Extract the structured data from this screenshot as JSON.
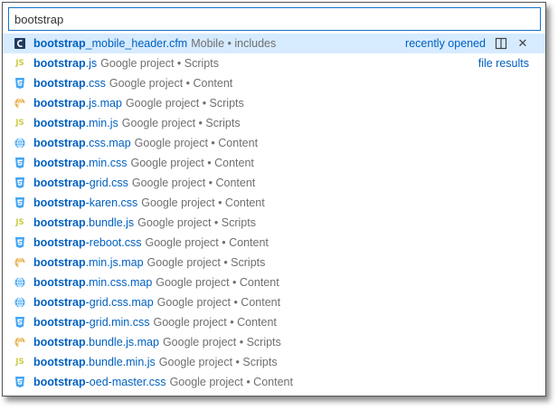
{
  "search": {
    "value": "bootstrap"
  },
  "selected_actions": {
    "split_icon": "split-editor-icon",
    "close_icon": "close-icon",
    "close_glyph": "✕"
  },
  "results": [
    {
      "icon": "coldfusion-icon",
      "match": "bootstrap",
      "rest": "_mobile_header.cfm",
      "desc": "Mobile • includes",
      "right": "recently opened",
      "selected": true
    },
    {
      "icon": "js-icon",
      "match": "bootstrap",
      "rest": ".js",
      "desc": "Google project • Scripts",
      "right": "file results"
    },
    {
      "icon": "css-icon",
      "match": "bootstrap",
      "rest": ".css",
      "desc": "Google project • Content"
    },
    {
      "icon": "js-map-icon",
      "match": "bootstrap",
      "rest": ".js.map",
      "desc": "Google project • Scripts"
    },
    {
      "icon": "js-icon",
      "match": "bootstrap",
      "rest": ".min.js",
      "desc": "Google project • Scripts"
    },
    {
      "icon": "css-map-icon",
      "match": "bootstrap",
      "rest": ".css.map",
      "desc": "Google project • Content"
    },
    {
      "icon": "css-icon",
      "match": "bootstrap",
      "rest": ".min.css",
      "desc": "Google project • Content"
    },
    {
      "icon": "css-icon",
      "match": "bootstrap",
      "rest": "-grid.css",
      "desc": "Google project • Content"
    },
    {
      "icon": "css-icon",
      "match": "bootstrap",
      "rest": "-karen.css",
      "desc": "Google project • Content"
    },
    {
      "icon": "js-icon",
      "match": "bootstrap",
      "rest": ".bundle.js",
      "desc": "Google project • Scripts"
    },
    {
      "icon": "css-icon",
      "match": "bootstrap",
      "rest": "-reboot.css",
      "desc": "Google project • Content"
    },
    {
      "icon": "js-map-icon",
      "match": "bootstrap",
      "rest": ".min.js.map",
      "desc": "Google project • Scripts"
    },
    {
      "icon": "css-map-icon",
      "match": "bootstrap",
      "rest": ".min.css.map",
      "desc": "Google project • Content"
    },
    {
      "icon": "css-map-icon",
      "match": "bootstrap",
      "rest": "-grid.css.map",
      "desc": "Google project • Content"
    },
    {
      "icon": "css-icon",
      "match": "bootstrap",
      "rest": "-grid.min.css",
      "desc": "Google project • Content"
    },
    {
      "icon": "js-map-icon",
      "match": "bootstrap",
      "rest": ".bundle.js.map",
      "desc": "Google project • Scripts"
    },
    {
      "icon": "js-icon",
      "match": "bootstrap",
      "rest": ".bundle.min.js",
      "desc": "Google project • Scripts"
    },
    {
      "icon": "css-icon",
      "match": "bootstrap",
      "rest": "-oed-master.css",
      "desc": "Google project • Content"
    }
  ],
  "icon_glyphs": {
    "js": "JS",
    "coldfusion": "C"
  },
  "colors": {
    "accent": "#0060c0",
    "selected_bg": "#d6ebff",
    "focus_border": "#1473c9",
    "css_icon": "#42a5f5",
    "js_icon": "#cbcb41",
    "cfm_icon": "#1e3a5f"
  }
}
